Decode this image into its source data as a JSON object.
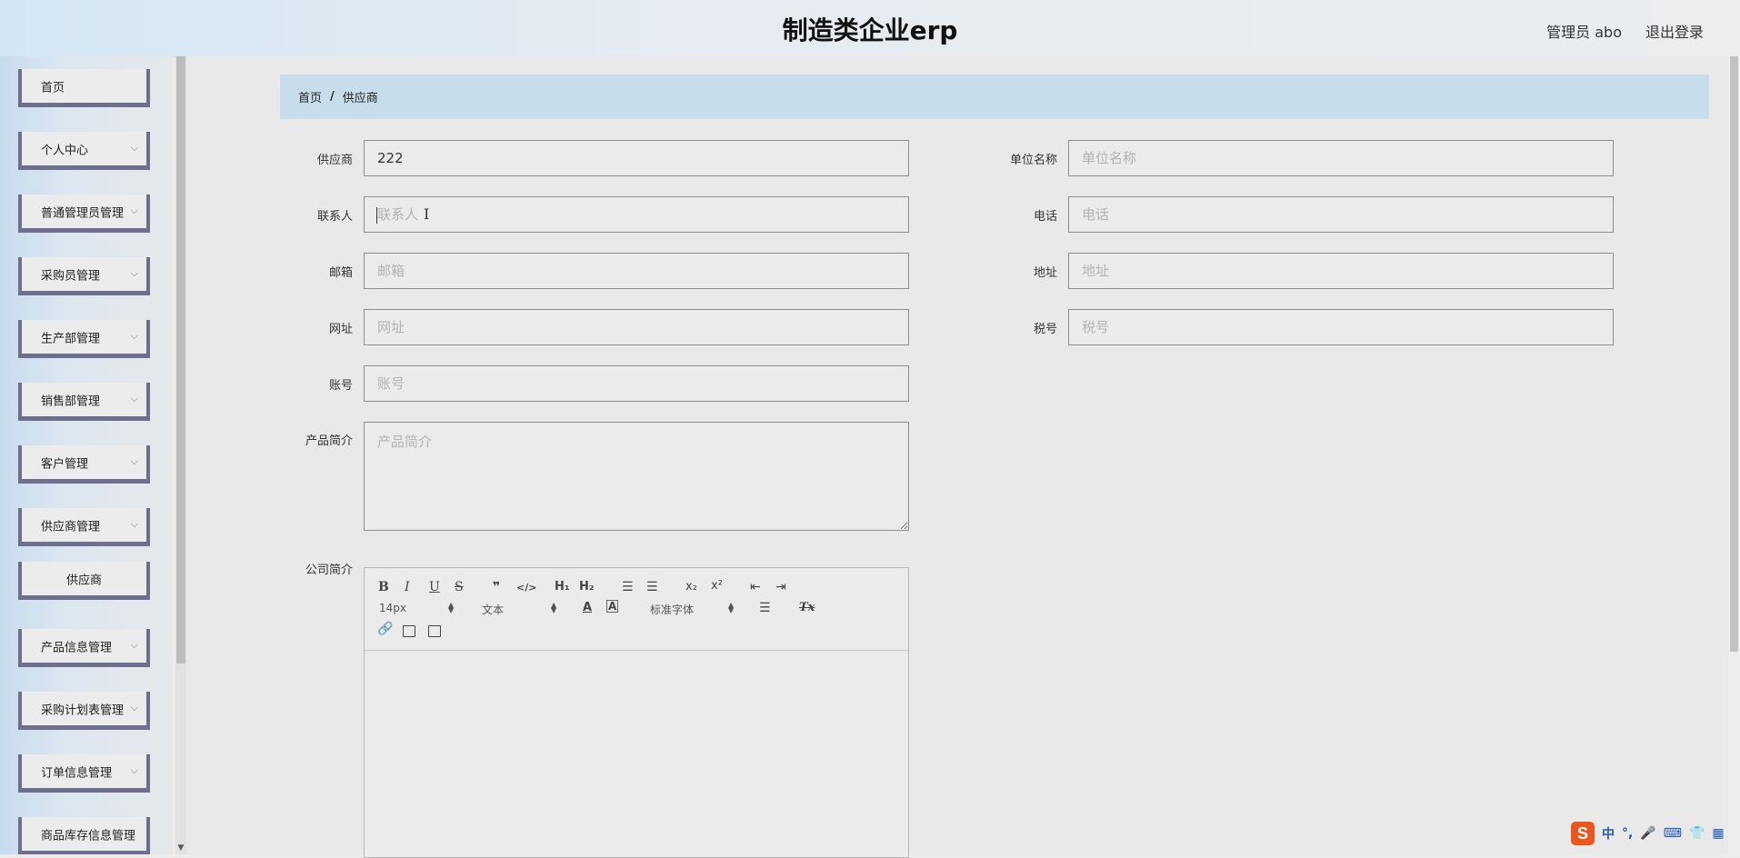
{
  "header": {
    "title": "制造类企业erp",
    "user": "管理员 abo",
    "logout": "退出登录"
  },
  "sidebar": {
    "items": [
      {
        "label": "首页",
        "chevron": false
      },
      {
        "label": "个人中心",
        "chevron": true
      },
      {
        "label": "普通管理员管理",
        "chevron": true
      },
      {
        "label": "采购员管理",
        "chevron": true
      },
      {
        "label": "生产部管理",
        "chevron": true
      },
      {
        "label": "销售部管理",
        "chevron": true
      },
      {
        "label": "客户管理",
        "chevron": true
      },
      {
        "label": "供应商管理",
        "chevron": true
      },
      {
        "label": "供应商",
        "chevron": false,
        "sub": true
      },
      {
        "label": "产品信息管理",
        "chevron": true
      },
      {
        "label": "采购计划表管理",
        "chevron": true
      },
      {
        "label": "订单信息管理",
        "chevron": true
      },
      {
        "label": "商品库存信息管理",
        "chevron": false
      }
    ],
    "chevron_glyph": "⌵"
  },
  "breadcrumb": {
    "home": "首页",
    "separator": "/",
    "current": "供应商"
  },
  "form": {
    "supplier": {
      "label": "供应商",
      "value": "222",
      "placeholder": ""
    },
    "company_name": {
      "label": "单位名称",
      "value": "",
      "placeholder": "单位名称"
    },
    "contact": {
      "label": "联系人",
      "value": "",
      "placeholder": "联系人"
    },
    "phone": {
      "label": "电话",
      "value": "",
      "placeholder": "电话"
    },
    "email": {
      "label": "邮箱",
      "value": "",
      "placeholder": "邮箱"
    },
    "address": {
      "label": "地址",
      "value": "",
      "placeholder": "地址"
    },
    "website": {
      "label": "网址",
      "value": "",
      "placeholder": "网址"
    },
    "tax_id": {
      "label": "税号",
      "value": "",
      "placeholder": "税号"
    },
    "account": {
      "label": "账号",
      "value": "",
      "placeholder": "账号"
    },
    "product_intro": {
      "label": "产品简介",
      "value": "",
      "placeholder": "产品简介"
    },
    "company_intro": {
      "label": "公司简介"
    }
  },
  "editor": {
    "toolbar": {
      "bold": "B",
      "italic": "I",
      "underline": "U",
      "strike": "S",
      "quote": "❞",
      "code": "</>",
      "h1": "H₁",
      "h2": "H₂",
      "ordered_list": "☰",
      "bullet_list": "☰",
      "subscript": "x₂",
      "superscript": "x²",
      "outdent": "⇤",
      "indent": "⇥",
      "font_size": "14px",
      "text_style": "文本",
      "font_family": "标准字体",
      "text_color": "A",
      "bg_color": "A",
      "align": "☰",
      "clear": "Tx"
    }
  },
  "ime": {
    "logo": "S",
    "lang": "中",
    "punct": "°,",
    "mic": "🎤",
    "kbd": "⌨",
    "shirt": "👕",
    "grid": "▦"
  }
}
